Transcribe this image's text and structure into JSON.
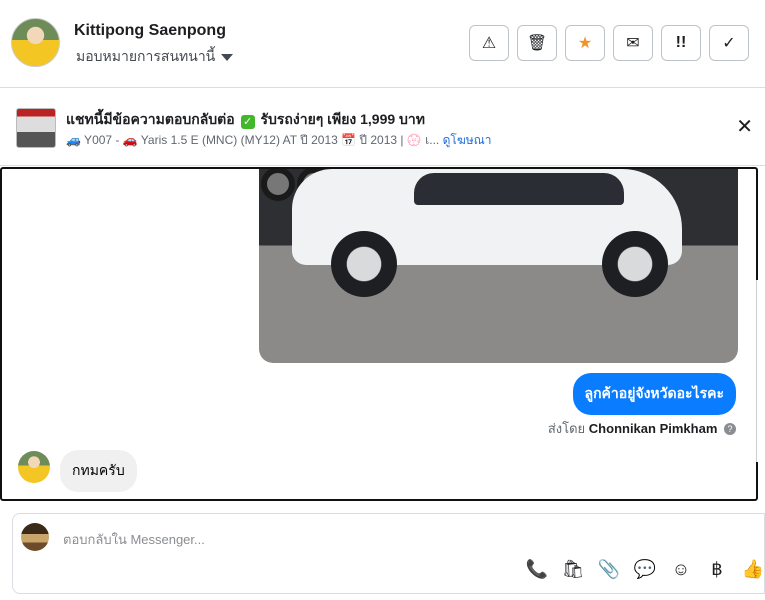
{
  "header": {
    "name": "Kittipong Saenpong",
    "assign_label": "มอบหมายการสนทนานี้",
    "actions": [
      {
        "name": "report-spam-button",
        "icon": "warning-icon",
        "glyph": "⚠"
      },
      {
        "name": "delete-button",
        "icon": "trash-icon",
        "glyph": "🗑"
      },
      {
        "name": "star-button",
        "icon": "star-icon",
        "glyph": "★"
      },
      {
        "name": "mark-unread-button",
        "icon": "envelope-open-icon",
        "glyph": "✉"
      },
      {
        "name": "follow-up-button",
        "icon": "double-exclaim-icon",
        "glyph": "!!"
      },
      {
        "name": "mark-done-button",
        "icon": "check-icon",
        "glyph": "✓"
      }
    ]
  },
  "ad": {
    "title_before": "แชทนี้มีข้อความตอบกลับต่อ",
    "title_after": "รับรถง่ายๆ เพียง 1,999 บาท",
    "subtitle": "🚙 Y007 - 🚗 Yaris 1.5 E (MNC) (MY12) AT ปี 2013 📅 ปี 2013 | 💮 เ...",
    "link": "ดูโฆษณา"
  },
  "messages": {
    "outgoing_text": "ลูกค้าอยู่จังหวัดอะไรคะ",
    "sent_by_prefix": "ส่งโดย",
    "sent_by_name": "Chonnikan Pimkham",
    "incoming_text": "กทมครับ"
  },
  "composer": {
    "placeholder": "ตอบกลับใน Messenger..."
  },
  "colors": {
    "accent": "#0a7cff",
    "star": "#f0932b"
  }
}
